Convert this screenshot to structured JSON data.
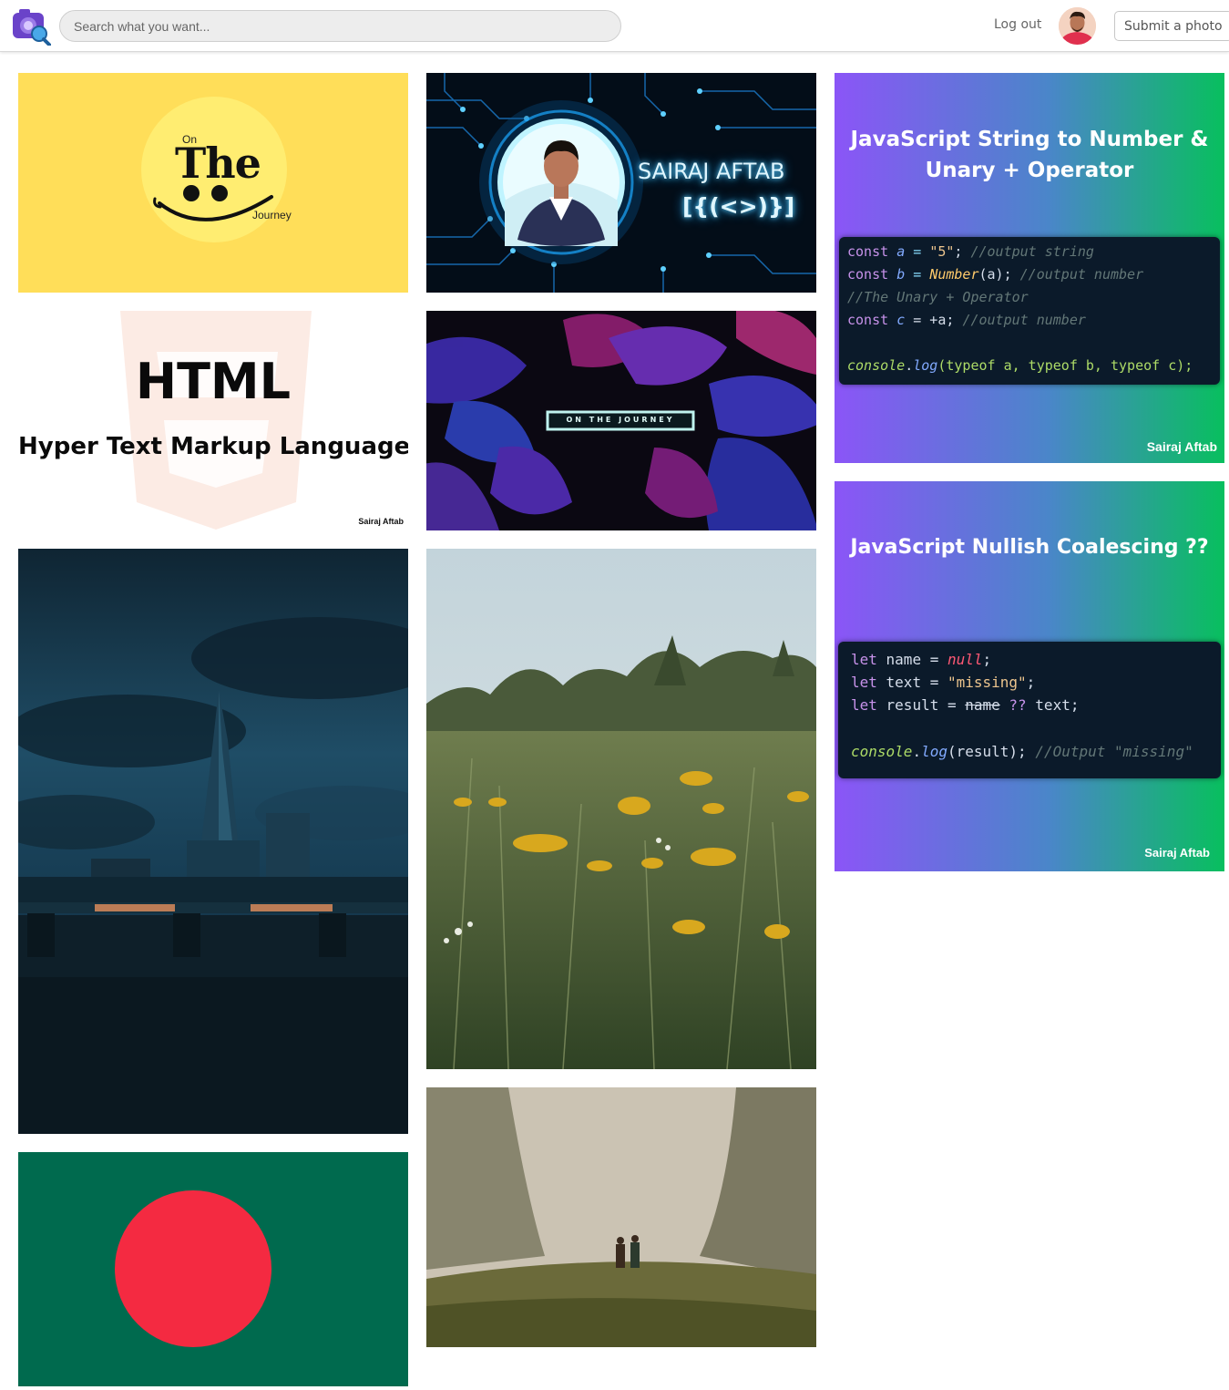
{
  "header": {
    "search_placeholder": "Search what you want...",
    "logout_label": "Log out",
    "submit_label": "Submit a photo"
  },
  "tiles": {
    "on_the_journey": {
      "on": "On",
      "the": "The",
      "journey": "Journey"
    },
    "sairaj": {
      "name": "SAIRAJ AFTAB",
      "code": "[{(<>)}]"
    },
    "js_string": {
      "title_line1": "JavaScript String to Number &",
      "title_line2": "Unary + Operator",
      "code": [
        [
          "const ",
          "a",
          " = ",
          "\"5\"",
          "; ",
          "//output string"
        ],
        [
          "const ",
          "b",
          " = ",
          "Number",
          "(a); ",
          "//output number"
        ],
        [
          "",
          "",
          "",
          "",
          "",
          "//The Unary + Operator"
        ],
        [
          "const ",
          "c",
          " = +a; ",
          "",
          "",
          "//output number"
        ],
        [
          "console",
          ".",
          "log",
          "(typeof a, typeof b, typeof c);",
          "",
          ""
        ]
      ],
      "author": "Sairaj Aftab"
    },
    "html": {
      "title": "HTML",
      "subtitle": "Hyper Text Markup Language",
      "author": "Sairaj Aftab"
    },
    "leaves": {
      "badge": "ON THE JOURNEY"
    },
    "js_nullish": {
      "title": "JavaScript Nullish Coalescing ??",
      "line1_kw": "let",
      "line1_var": " name = ",
      "line1_val": "null",
      "line1_end": ";",
      "line2_kw": "let",
      "line2_var": " text = ",
      "line2_val": "\"missing\"",
      "line2_end": ";",
      "line3_kw": "let",
      "line3_var": " result = ",
      "line3_strike": "name",
      "line3_op": " ?? ",
      "line3_end": "text;",
      "line4_obj": "console",
      "line4_dot": ".",
      "line4_fn": "log",
      "line4_args": "(result); ",
      "line4_comment": "//Output \"missing\"",
      "author": "Sairaj Aftab"
    }
  },
  "colors": {
    "yellow": "#ffde59",
    "green_flag": "#006a4e",
    "red_flag": "#f42a41",
    "grad_start": "#8b55f7",
    "grad_end": "#08bf5e",
    "code_bg": "#0b1a2a"
  }
}
